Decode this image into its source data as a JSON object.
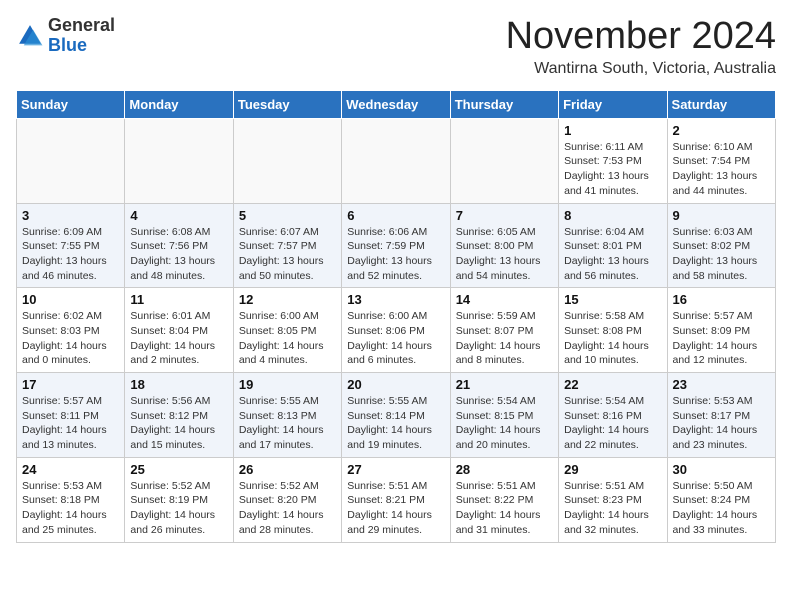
{
  "header": {
    "logo_general": "General",
    "logo_blue": "Blue",
    "month_title": "November 2024",
    "subtitle": "Wantirna South, Victoria, Australia"
  },
  "days_of_week": [
    "Sunday",
    "Monday",
    "Tuesday",
    "Wednesday",
    "Thursday",
    "Friday",
    "Saturday"
  ],
  "weeks": [
    [
      {
        "day": "",
        "info": ""
      },
      {
        "day": "",
        "info": ""
      },
      {
        "day": "",
        "info": ""
      },
      {
        "day": "",
        "info": ""
      },
      {
        "day": "",
        "info": ""
      },
      {
        "day": "1",
        "info": "Sunrise: 6:11 AM\nSunset: 7:53 PM\nDaylight: 13 hours\nand 41 minutes."
      },
      {
        "day": "2",
        "info": "Sunrise: 6:10 AM\nSunset: 7:54 PM\nDaylight: 13 hours\nand 44 minutes."
      }
    ],
    [
      {
        "day": "3",
        "info": "Sunrise: 6:09 AM\nSunset: 7:55 PM\nDaylight: 13 hours\nand 46 minutes."
      },
      {
        "day": "4",
        "info": "Sunrise: 6:08 AM\nSunset: 7:56 PM\nDaylight: 13 hours\nand 48 minutes."
      },
      {
        "day": "5",
        "info": "Sunrise: 6:07 AM\nSunset: 7:57 PM\nDaylight: 13 hours\nand 50 minutes."
      },
      {
        "day": "6",
        "info": "Sunrise: 6:06 AM\nSunset: 7:59 PM\nDaylight: 13 hours\nand 52 minutes."
      },
      {
        "day": "7",
        "info": "Sunrise: 6:05 AM\nSunset: 8:00 PM\nDaylight: 13 hours\nand 54 minutes."
      },
      {
        "day": "8",
        "info": "Sunrise: 6:04 AM\nSunset: 8:01 PM\nDaylight: 13 hours\nand 56 minutes."
      },
      {
        "day": "9",
        "info": "Sunrise: 6:03 AM\nSunset: 8:02 PM\nDaylight: 13 hours\nand 58 minutes."
      }
    ],
    [
      {
        "day": "10",
        "info": "Sunrise: 6:02 AM\nSunset: 8:03 PM\nDaylight: 14 hours\nand 0 minutes."
      },
      {
        "day": "11",
        "info": "Sunrise: 6:01 AM\nSunset: 8:04 PM\nDaylight: 14 hours\nand 2 minutes."
      },
      {
        "day": "12",
        "info": "Sunrise: 6:00 AM\nSunset: 8:05 PM\nDaylight: 14 hours\nand 4 minutes."
      },
      {
        "day": "13",
        "info": "Sunrise: 6:00 AM\nSunset: 8:06 PM\nDaylight: 14 hours\nand 6 minutes."
      },
      {
        "day": "14",
        "info": "Sunrise: 5:59 AM\nSunset: 8:07 PM\nDaylight: 14 hours\nand 8 minutes."
      },
      {
        "day": "15",
        "info": "Sunrise: 5:58 AM\nSunset: 8:08 PM\nDaylight: 14 hours\nand 10 minutes."
      },
      {
        "day": "16",
        "info": "Sunrise: 5:57 AM\nSunset: 8:09 PM\nDaylight: 14 hours\nand 12 minutes."
      }
    ],
    [
      {
        "day": "17",
        "info": "Sunrise: 5:57 AM\nSunset: 8:11 PM\nDaylight: 14 hours\nand 13 minutes."
      },
      {
        "day": "18",
        "info": "Sunrise: 5:56 AM\nSunset: 8:12 PM\nDaylight: 14 hours\nand 15 minutes."
      },
      {
        "day": "19",
        "info": "Sunrise: 5:55 AM\nSunset: 8:13 PM\nDaylight: 14 hours\nand 17 minutes."
      },
      {
        "day": "20",
        "info": "Sunrise: 5:55 AM\nSunset: 8:14 PM\nDaylight: 14 hours\nand 19 minutes."
      },
      {
        "day": "21",
        "info": "Sunrise: 5:54 AM\nSunset: 8:15 PM\nDaylight: 14 hours\nand 20 minutes."
      },
      {
        "day": "22",
        "info": "Sunrise: 5:54 AM\nSunset: 8:16 PM\nDaylight: 14 hours\nand 22 minutes."
      },
      {
        "day": "23",
        "info": "Sunrise: 5:53 AM\nSunset: 8:17 PM\nDaylight: 14 hours\nand 23 minutes."
      }
    ],
    [
      {
        "day": "24",
        "info": "Sunrise: 5:53 AM\nSunset: 8:18 PM\nDaylight: 14 hours\nand 25 minutes."
      },
      {
        "day": "25",
        "info": "Sunrise: 5:52 AM\nSunset: 8:19 PM\nDaylight: 14 hours\nand 26 minutes."
      },
      {
        "day": "26",
        "info": "Sunrise: 5:52 AM\nSunset: 8:20 PM\nDaylight: 14 hours\nand 28 minutes."
      },
      {
        "day": "27",
        "info": "Sunrise: 5:51 AM\nSunset: 8:21 PM\nDaylight: 14 hours\nand 29 minutes."
      },
      {
        "day": "28",
        "info": "Sunrise: 5:51 AM\nSunset: 8:22 PM\nDaylight: 14 hours\nand 31 minutes."
      },
      {
        "day": "29",
        "info": "Sunrise: 5:51 AM\nSunset: 8:23 PM\nDaylight: 14 hours\nand 32 minutes."
      },
      {
        "day": "30",
        "info": "Sunrise: 5:50 AM\nSunset: 8:24 PM\nDaylight: 14 hours\nand 33 minutes."
      }
    ]
  ]
}
